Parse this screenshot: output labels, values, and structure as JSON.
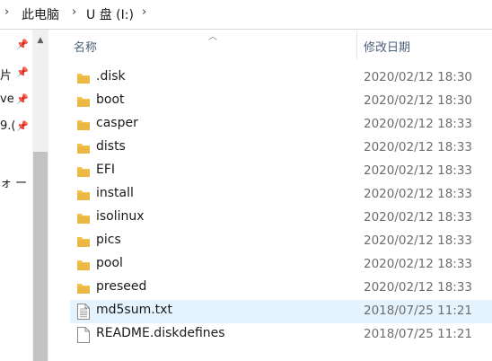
{
  "address_bar": {
    "crumbs": [
      "此电脑",
      "U 盘 (I:)"
    ]
  },
  "nav_pane": {
    "items": [
      "片",
      "ve",
      "9.(",
      "ォ ー"
    ]
  },
  "file_list": {
    "columns": {
      "name": "名称",
      "modified": "修改日期"
    },
    "sort_column": "name",
    "rows": [
      {
        "name": ".disk",
        "modified": "2020/02/12 18:30",
        "type": "folder"
      },
      {
        "name": "boot",
        "modified": "2020/02/12 18:30",
        "type": "folder"
      },
      {
        "name": "casper",
        "modified": "2020/02/12 18:33",
        "type": "folder"
      },
      {
        "name": "dists",
        "modified": "2020/02/12 18:33",
        "type": "folder"
      },
      {
        "name": "EFI",
        "modified": "2020/02/12 18:33",
        "type": "folder"
      },
      {
        "name": "install",
        "modified": "2020/02/12 18:33",
        "type": "folder"
      },
      {
        "name": "isolinux",
        "modified": "2020/02/12 18:33",
        "type": "folder"
      },
      {
        "name": "pics",
        "modified": "2020/02/12 18:33",
        "type": "folder"
      },
      {
        "name": "pool",
        "modified": "2020/02/12 18:33",
        "type": "folder"
      },
      {
        "name": "preseed",
        "modified": "2020/02/12 18:33",
        "type": "folder"
      },
      {
        "name": "md5sum.txt",
        "modified": "2018/07/25 11:21",
        "type": "file",
        "selected": true
      },
      {
        "name": "README.diskdefines",
        "modified": "2018/07/25 11:21",
        "type": "file"
      }
    ]
  },
  "colors": {
    "folder": "#f4c24f",
    "folder_dark": "#d9a632",
    "selection": "#e5f3ff",
    "header_text": "#4c607a"
  }
}
